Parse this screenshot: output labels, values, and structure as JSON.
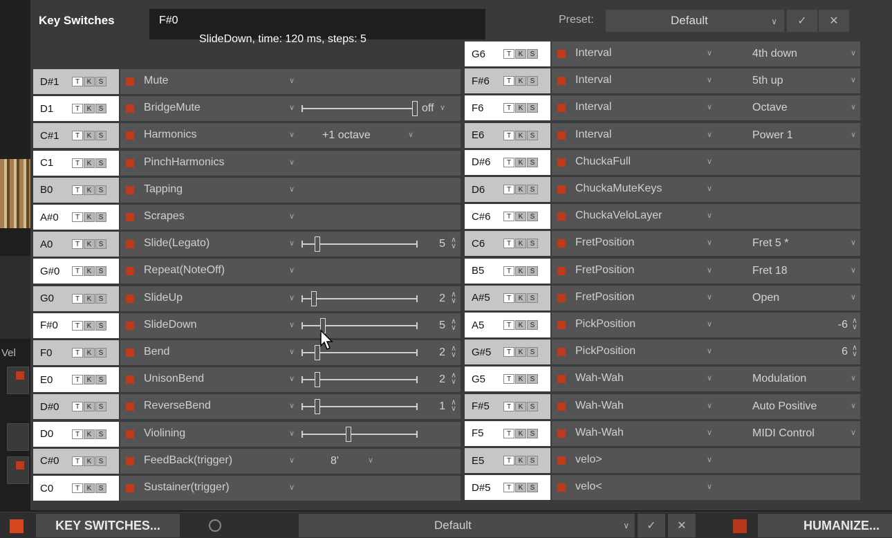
{
  "bg": {
    "vel_label": "Vel"
  },
  "panel": {
    "title": "Key Switches",
    "info_note": "F#0",
    "info_desc": "SlideDown, time: 120 ms, steps: 5",
    "preset_label": "Preset:",
    "preset_value": "Default",
    "confirm_icon": "✓",
    "cancel_icon": "✕"
  },
  "tks": [
    "T",
    "K",
    "S"
  ],
  "left_rows": [
    {
      "note": "D#1",
      "name": "Mute",
      "kind": "none"
    },
    {
      "note": "D1",
      "name": "BridgeMute",
      "kind": "slider",
      "value_pct": 100,
      "param": "off"
    },
    {
      "note": "C#1",
      "name": "Harmonics",
      "kind": "dropdown",
      "param": "+1 octave"
    },
    {
      "note": "C1",
      "name": "PinchHarmonics",
      "kind": "none"
    },
    {
      "note": "B0",
      "name": "Tapping",
      "kind": "none"
    },
    {
      "note": "A#0",
      "name": "Scrapes",
      "kind": "none"
    },
    {
      "note": "A0",
      "name": "Slide(Legato)",
      "kind": "slider",
      "value_pct": 12,
      "param": "5"
    },
    {
      "note": "G#0",
      "name": "Repeat(NoteOff)",
      "kind": "none"
    },
    {
      "note": "G0",
      "name": "SlideUp",
      "kind": "slider",
      "value_pct": 9,
      "param": "2"
    },
    {
      "note": "F#0",
      "name": "SlideDown",
      "kind": "slider",
      "value_pct": 17,
      "param": "5"
    },
    {
      "note": "F0",
      "name": "Bend",
      "kind": "slider",
      "value_pct": 12,
      "param": "2"
    },
    {
      "note": "E0",
      "name": "UnisonBend",
      "kind": "slider",
      "value_pct": 12,
      "param": "2"
    },
    {
      "note": "D#0",
      "name": "ReverseBend",
      "kind": "slider",
      "value_pct": 12,
      "param": "1"
    },
    {
      "note": "D0",
      "name": "Violining",
      "kind": "slider",
      "value_pct": 40,
      "param": ""
    },
    {
      "note": "C#0",
      "name": "FeedBack(trigger)",
      "kind": "dropdown",
      "param": "8'"
    },
    {
      "note": "C0",
      "name": "Sustainer(trigger)",
      "kind": "none"
    }
  ],
  "right_rows": [
    {
      "note": "G6",
      "name": "Interval",
      "kind": "dropdown",
      "param": "4th down"
    },
    {
      "note": "F#6",
      "name": "Interval",
      "kind": "dropdown",
      "param": "5th up"
    },
    {
      "note": "F6",
      "name": "Interval",
      "kind": "dropdown",
      "param": "Octave"
    },
    {
      "note": "E6",
      "name": "Interval",
      "kind": "dropdown",
      "param": "Power 1"
    },
    {
      "note": "D#6",
      "name": "ChuckaFull",
      "kind": "none"
    },
    {
      "note": "D6",
      "name": "ChuckaMuteKeys",
      "kind": "none"
    },
    {
      "note": "C#6",
      "name": "ChuckaVeloLayer",
      "kind": "none"
    },
    {
      "note": "C6",
      "name": "FretPosition",
      "kind": "dropdown",
      "param": "Fret 5  *"
    },
    {
      "note": "B5",
      "name": "FretPosition",
      "kind": "dropdown",
      "param": "Fret 18"
    },
    {
      "note": "A#5",
      "name": "FretPosition",
      "kind": "dropdown",
      "param": "Open"
    },
    {
      "note": "A5",
      "name": "PickPosition",
      "kind": "spin",
      "param": "-6"
    },
    {
      "note": "G#5",
      "name": "PickPosition",
      "kind": "spin",
      "param": "6"
    },
    {
      "note": "G5",
      "name": "Wah-Wah",
      "kind": "dropdown",
      "param": "Modulation"
    },
    {
      "note": "F#5",
      "name": "Wah-Wah",
      "kind": "dropdown",
      "param": "Auto Positive"
    },
    {
      "note": "F5",
      "name": "Wah-Wah",
      "kind": "dropdown",
      "param": "MIDI Control"
    },
    {
      "note": "E5",
      "name": "velo>",
      "kind": "none"
    },
    {
      "note": "D#5",
      "name": "velo<",
      "kind": "none"
    }
  ],
  "bottom_bar": {
    "keyswitch_label": "KEY SWITCHES...",
    "preset_value": "Default",
    "confirm_icon": "✓",
    "cancel_icon": "✕",
    "humanize_label": "HUMANIZE..."
  }
}
